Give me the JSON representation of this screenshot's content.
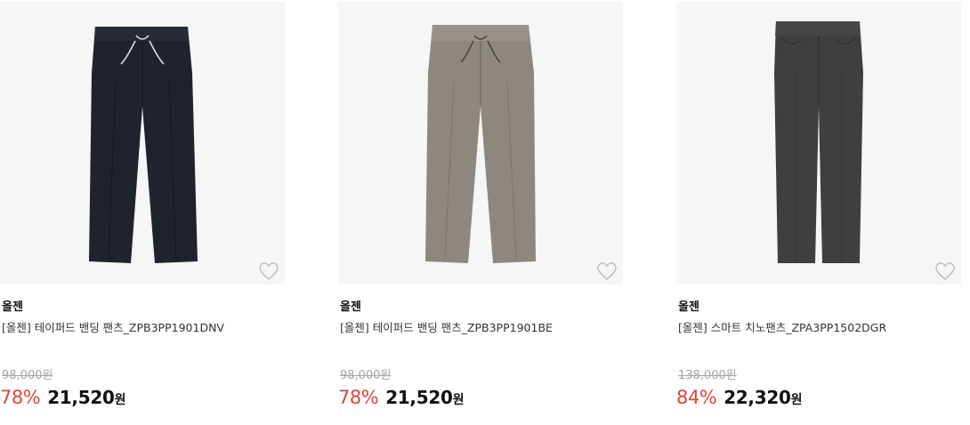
{
  "products": [
    {
      "brand": "올젠",
      "name": "[올젠] 테이퍼드 밴딩 팬츠_ZPB3PP1901DNV",
      "original_price": "98,000원",
      "discount_rate": "78%",
      "sale_price": "21,520",
      "currency": "원",
      "color": "#1f232d",
      "wish_icon": "heart-outline-icon"
    },
    {
      "brand": "올젠",
      "name": "[올젠] 테이퍼드 밴딩 팬츠_ZPB3PP1901BE",
      "original_price": "98,000원",
      "discount_rate": "78%",
      "sale_price": "21,520",
      "currency": "원",
      "color": "#8e8780",
      "wish_icon": "heart-outline-icon"
    },
    {
      "brand": "올젠",
      "name": "[올젠] 스마트 치노팬츠_ZPA3PP1502DGR",
      "original_price": "138,000원",
      "discount_rate": "84%",
      "sale_price": "22,320",
      "currency": "원",
      "color": "#3e3f41",
      "wish_icon": "heart-outline-icon"
    }
  ],
  "colors": {
    "discount": "#e0433a",
    "thumb_bg": "#f6f6f6",
    "strike_price": "#a5a5a5"
  }
}
